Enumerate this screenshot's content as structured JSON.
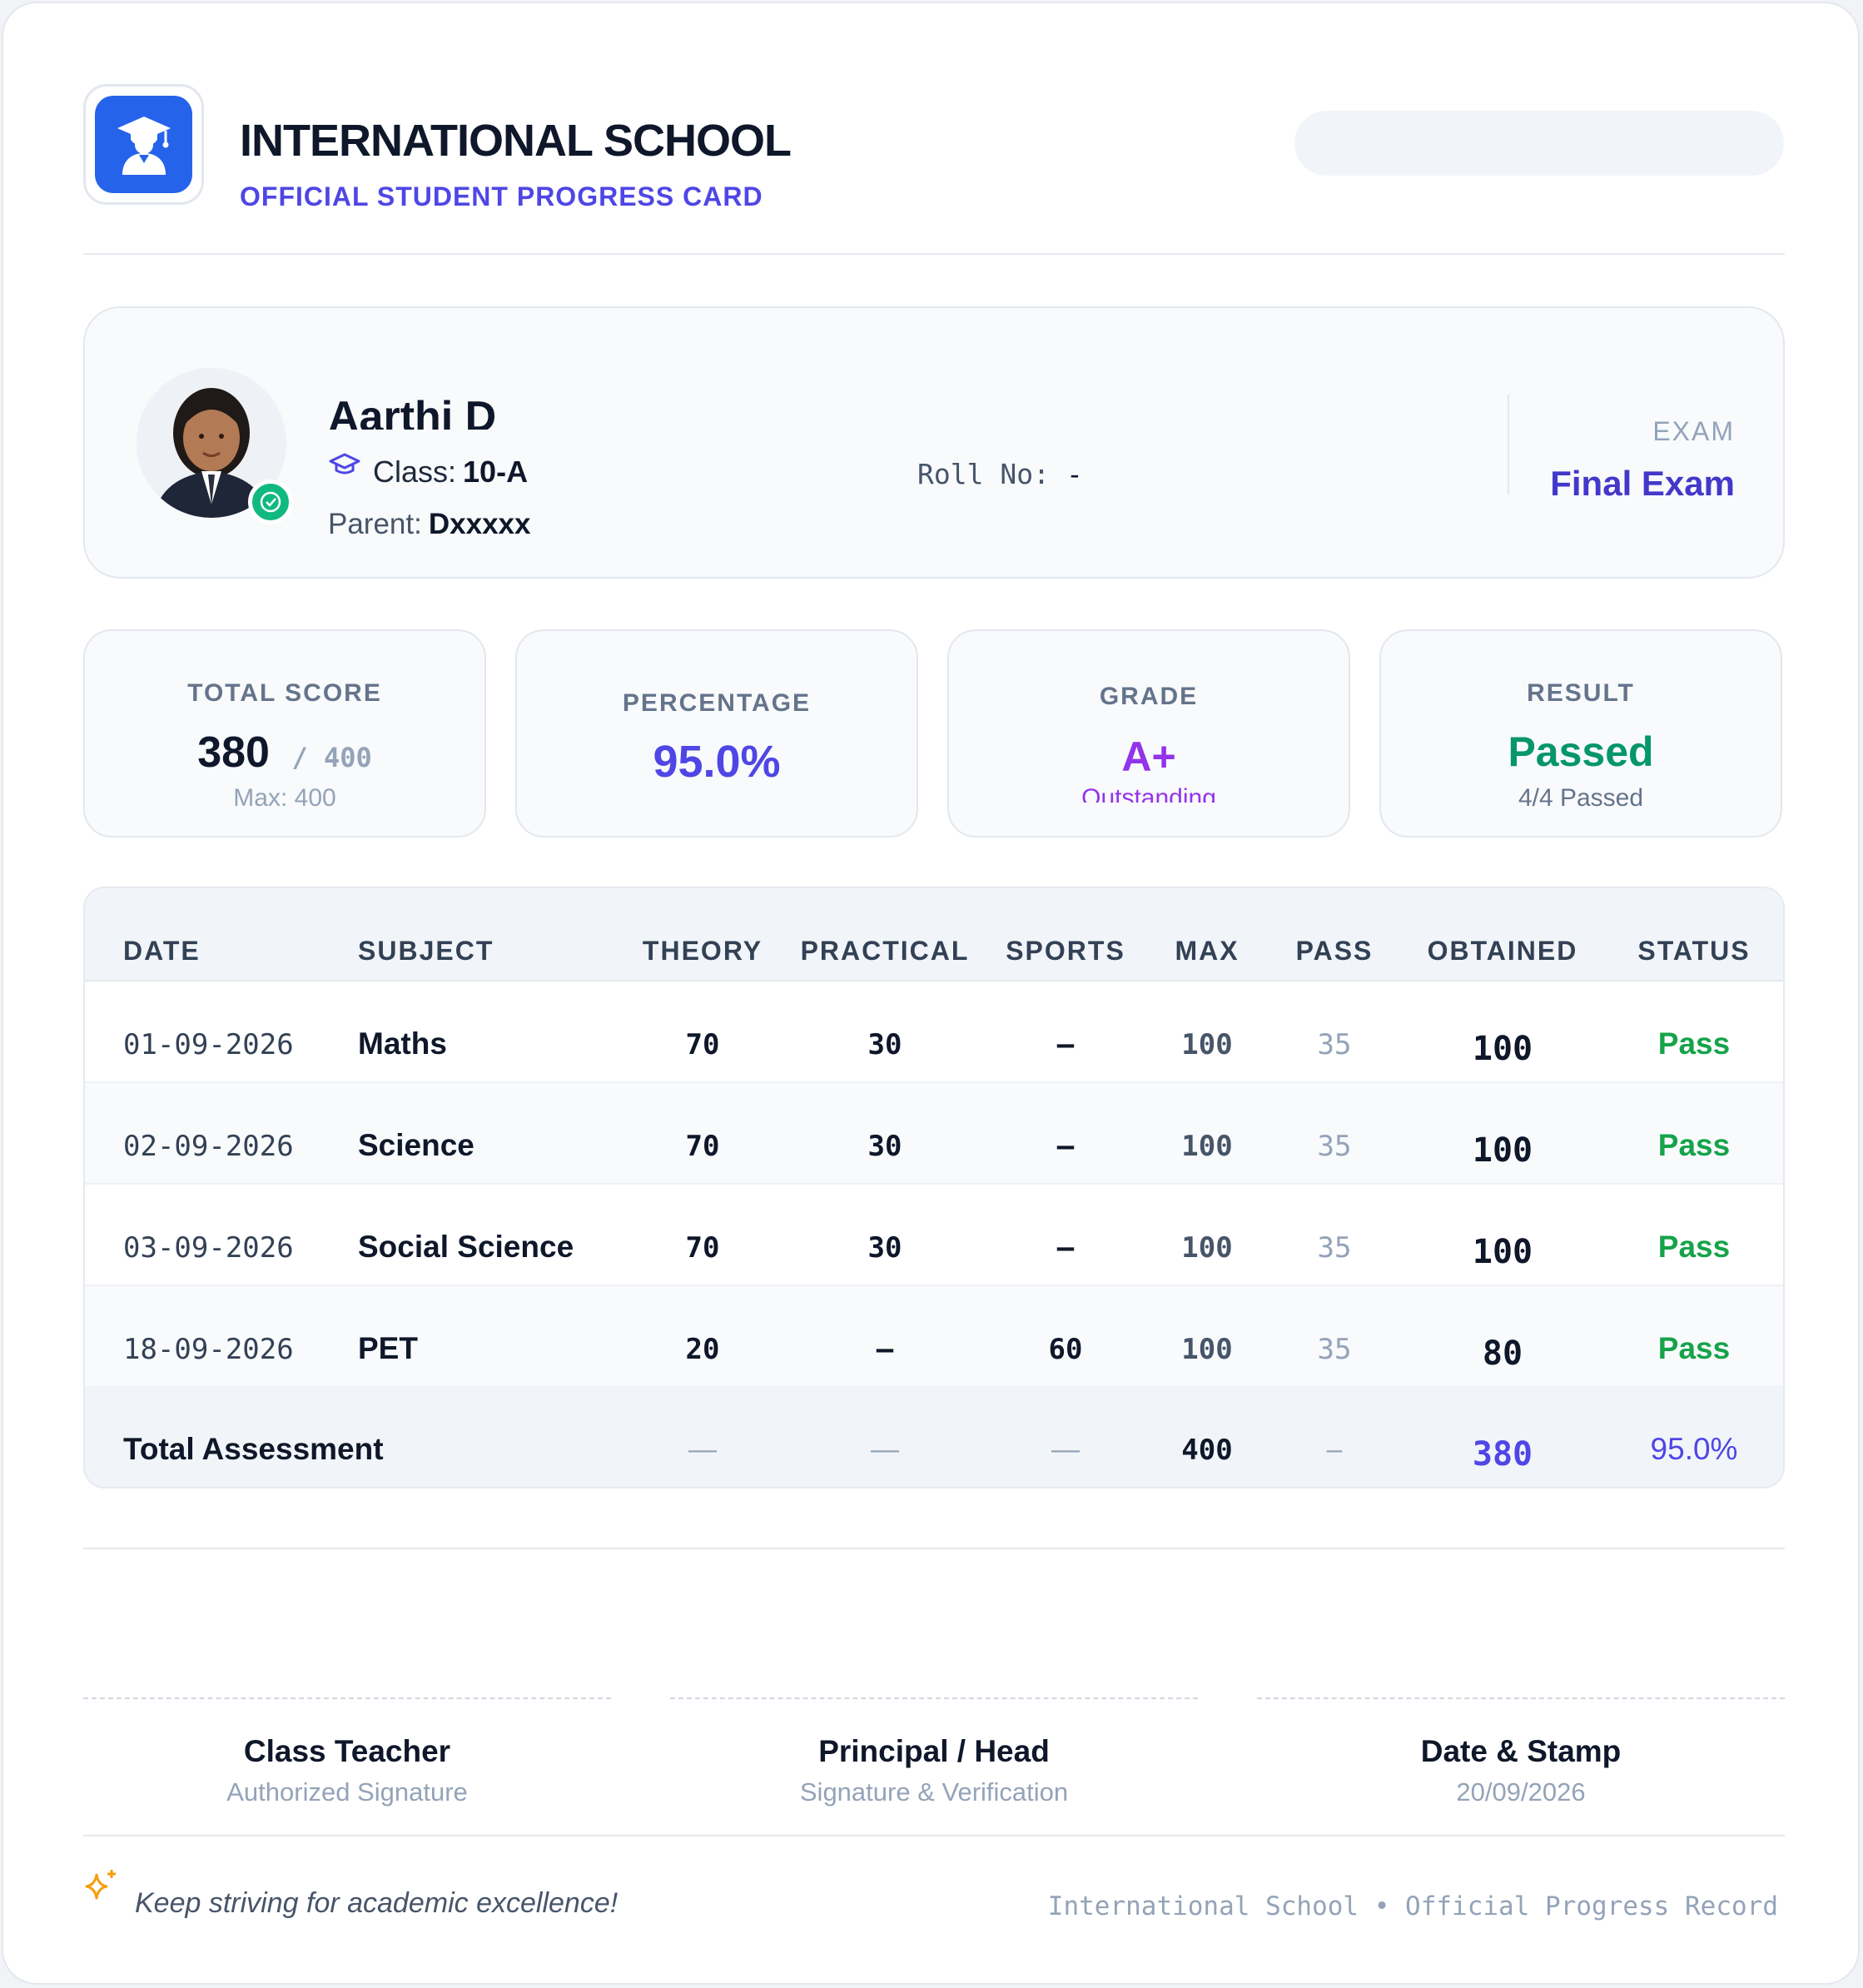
{
  "header": {
    "school_name": "INTERNATIONAL SCHOOL",
    "subtitle": "OFFICIAL STUDENT PROGRESS CARD",
    "logo_icon": "graduate-student-icon",
    "brand_color": "#2563eb",
    "accent_color": "#4f46e5"
  },
  "student": {
    "name": "Aarthi D",
    "class_label": "Class:",
    "class_value": "10-A",
    "parent_label": "Parent:",
    "parent_value": "Dxxxxx",
    "roll_label": "Roll No:",
    "roll_value": "-",
    "exam_label": "EXAM",
    "exam_value": "Final Exam",
    "verified_icon": "check-circle-icon"
  },
  "stats": {
    "total_score": {
      "label": "TOTAL SCORE",
      "value": "380",
      "out_of": "/ 400",
      "sub": "Max: 400"
    },
    "percentage": {
      "label": "PERCENTAGE",
      "value": "95.0%"
    },
    "grade": {
      "label": "GRADE",
      "value": "A+",
      "sub": "Outstanding",
      "color": "#9333ea"
    },
    "result": {
      "label": "RESULT",
      "value": "Passed",
      "sub": "4/4 Passed",
      "color": "#059669"
    }
  },
  "table": {
    "headers": [
      "DATE",
      "SUBJECT",
      "THEORY",
      "PRACTICAL",
      "SPORTS",
      "MAX",
      "PASS",
      "OBTAINED",
      "STATUS"
    ],
    "rows": [
      {
        "date": "01-09-2026",
        "subject": "Maths",
        "theory": "70",
        "practical": "30",
        "sports": "–",
        "max": "100",
        "pass": "35",
        "obtained": "100",
        "status": "Pass"
      },
      {
        "date": "02-09-2026",
        "subject": "Science",
        "theory": "70",
        "practical": "30",
        "sports": "–",
        "max": "100",
        "pass": "35",
        "obtained": "100",
        "status": "Pass"
      },
      {
        "date": "03-09-2026",
        "subject": "Social Science",
        "theory": "70",
        "practical": "30",
        "sports": "–",
        "max": "100",
        "pass": "35",
        "obtained": "100",
        "status": "Pass"
      },
      {
        "date": "18-09-2026",
        "subject": "PET",
        "theory": "20",
        "practical": "–",
        "sports": "60",
        "max": "100",
        "pass": "35",
        "obtained": "80",
        "status": "Pass"
      }
    ],
    "total": {
      "label": "Total Assessment",
      "theory": "—",
      "practical": "—",
      "sports": "—",
      "max": "400",
      "pass": "–",
      "obtained": "380",
      "percentage": "95.0%"
    }
  },
  "signatures": [
    {
      "title": "Class Teacher",
      "sub": "Authorized Signature"
    },
    {
      "title": "Principal / Head",
      "sub": "Signature & Verification"
    },
    {
      "title": "Date & Stamp",
      "sub": "20/09/2026"
    }
  ],
  "footer": {
    "quote": "Keep striving for academic excellence!",
    "right": "International School • Official Progress Record",
    "sparkle_icon": "sparkle-icon"
  }
}
